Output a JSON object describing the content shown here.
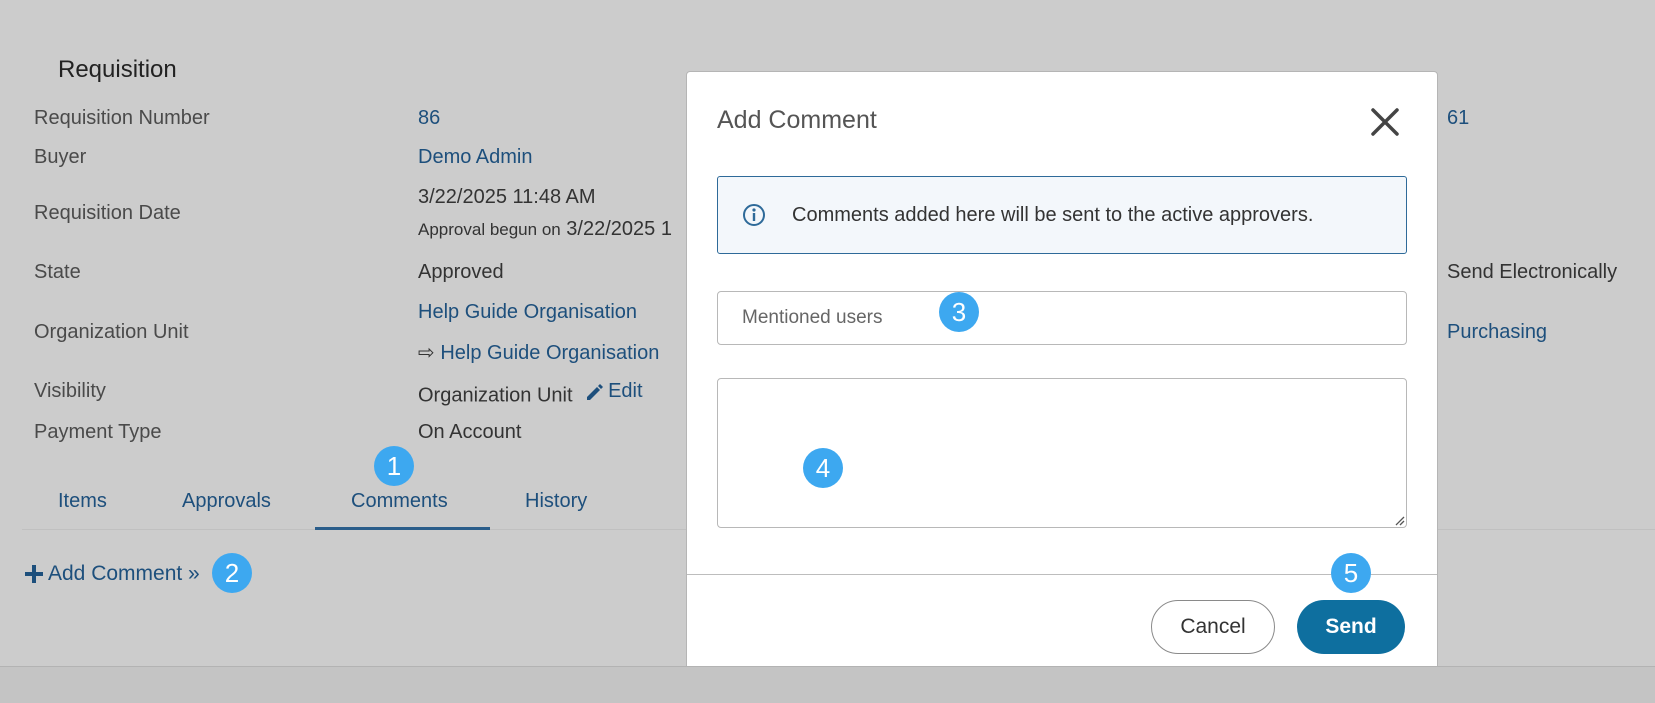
{
  "section": {
    "title": "Requisition"
  },
  "details": {
    "requisition_number": {
      "label": "Requisition Number",
      "value": "86"
    },
    "buyer": {
      "label": "Buyer",
      "value": "Demo Admin"
    },
    "requisition_date": {
      "label": "Requisition Date",
      "value": "3/22/2025 11:48 AM",
      "sub_prefix": "Approval begun on",
      "sub_value": "3/22/2025 1"
    },
    "state": {
      "label": "State",
      "value": "Approved"
    },
    "organization_unit": {
      "label": "Organization Unit",
      "value": "Help Guide Organisation",
      "sub_arrow": "⇨",
      "sub_value": "Help Guide Organisation"
    },
    "visibility": {
      "label": "Visibility",
      "value": "Organization Unit",
      "edit_label": "Edit"
    },
    "payment_type": {
      "label": "Payment Type",
      "value": "On Account"
    }
  },
  "right_column": {
    "number_fragment": "61",
    "send_method": "Send Electronically",
    "department": "Purchasing"
  },
  "tabs": [
    {
      "label": "Items"
    },
    {
      "label": "Approvals"
    },
    {
      "label": "Comments"
    },
    {
      "label": "History"
    }
  ],
  "add_comment": {
    "plus": "+",
    "label": "Add Comment »"
  },
  "badges": [
    "1",
    "2",
    "3",
    "4",
    "5"
  ],
  "modal": {
    "title": "Add Comment",
    "info_text": "Comments added here will be sent to the active approvers.",
    "mentions_placeholder": "Mentioned users",
    "comment_value": "",
    "cancel_label": "Cancel",
    "send_label": "Send"
  },
  "colors": {
    "link": "#1d4f7c",
    "badge": "#3da8f0",
    "send_button": "#0e6f9f",
    "info_border": "#2e6a99",
    "overlay": "#cccccc"
  },
  "icons": {
    "close": "close-icon",
    "info": "info-icon",
    "edit": "pencil-icon",
    "plus": "plus-icon"
  }
}
